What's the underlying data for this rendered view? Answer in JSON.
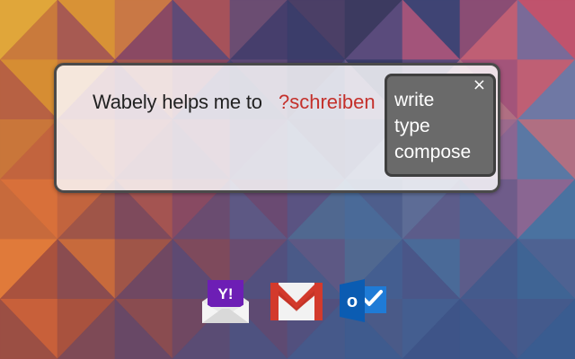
{
  "prompt": {
    "sentence": "Wabely helps me to",
    "highlighted_word": "?schreiben",
    "highlight_color": "#c4302b"
  },
  "suggestions": {
    "items": [
      "write",
      "type",
      "compose"
    ],
    "close_label": "×"
  },
  "app_icons": [
    {
      "name": "yahoo-mail-icon",
      "label": "Y!"
    },
    {
      "name": "gmail-icon"
    },
    {
      "name": "outlook-icon",
      "label": "o"
    }
  ]
}
